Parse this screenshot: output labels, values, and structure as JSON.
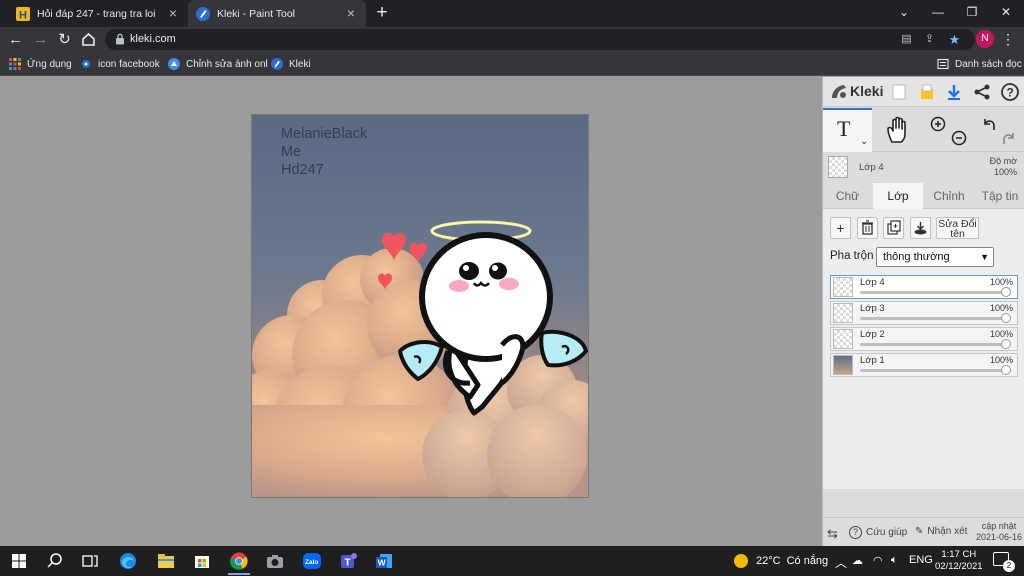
{
  "browser": {
    "tabs": [
      {
        "title": "Hỏi đáp 247 - trang tra loi",
        "active": false
      },
      {
        "title": "Kleki - Paint Tool",
        "active": true
      }
    ],
    "url": "kleki.com",
    "profile_initial": "N",
    "bookmarks": [
      {
        "label": "Ứng dụng",
        "icon": "apps-grid-icon"
      },
      {
        "label": "icon facebook",
        "icon": "blue-dot-icon"
      },
      {
        "label": "Chỉnh sửa ảnh onl",
        "icon": "photo-editor-icon"
      },
      {
        "label": "Kleki",
        "icon": "kleki-icon"
      }
    ],
    "reading_list": "Danh sách đọc"
  },
  "canvas": {
    "text_lines": [
      "MelanieBlack",
      "Me",
      "Hd247"
    ]
  },
  "kleki": {
    "title": "Kleki",
    "active_tool": "text-tool",
    "current_layer": {
      "name": "Lớp 4",
      "opacity_label": "Độ mờ",
      "opacity": "100%"
    },
    "tabs": [
      "Chữ",
      "Lớp",
      "Chỉnh",
      "Tập tin"
    ],
    "active_tab": "Lớp",
    "layer_buttons": {
      "add": "+",
      "rename": "Sửa Đổi tên"
    },
    "blend_label": "Pha trộn",
    "blend_mode": "thông thường",
    "layers": [
      {
        "name": "Lớp 4",
        "opacity": "100%",
        "active": true
      },
      {
        "name": "Lớp 3",
        "opacity": "100%",
        "active": false
      },
      {
        "name": "Lớp 2",
        "opacity": "100%",
        "active": false
      },
      {
        "name": "Lớp 1",
        "opacity": "100%",
        "active": false
      }
    ],
    "footer": {
      "help": "Cứu giúp",
      "feedback": "Nhận xét",
      "update_label": "cập nhật",
      "update_date": "2021-06-16"
    }
  },
  "taskbar": {
    "weather_temp": "22°C",
    "weather_text": "Có nắng",
    "language": "ENG",
    "time": "1:17 CH",
    "date": "02/12/2021",
    "notification_count": "2"
  },
  "colors": {
    "accent": "#3a72c4",
    "chrome_dark": "#202124",
    "chrome_toolbar": "#35363a",
    "workspace": "#9c9c9c"
  }
}
